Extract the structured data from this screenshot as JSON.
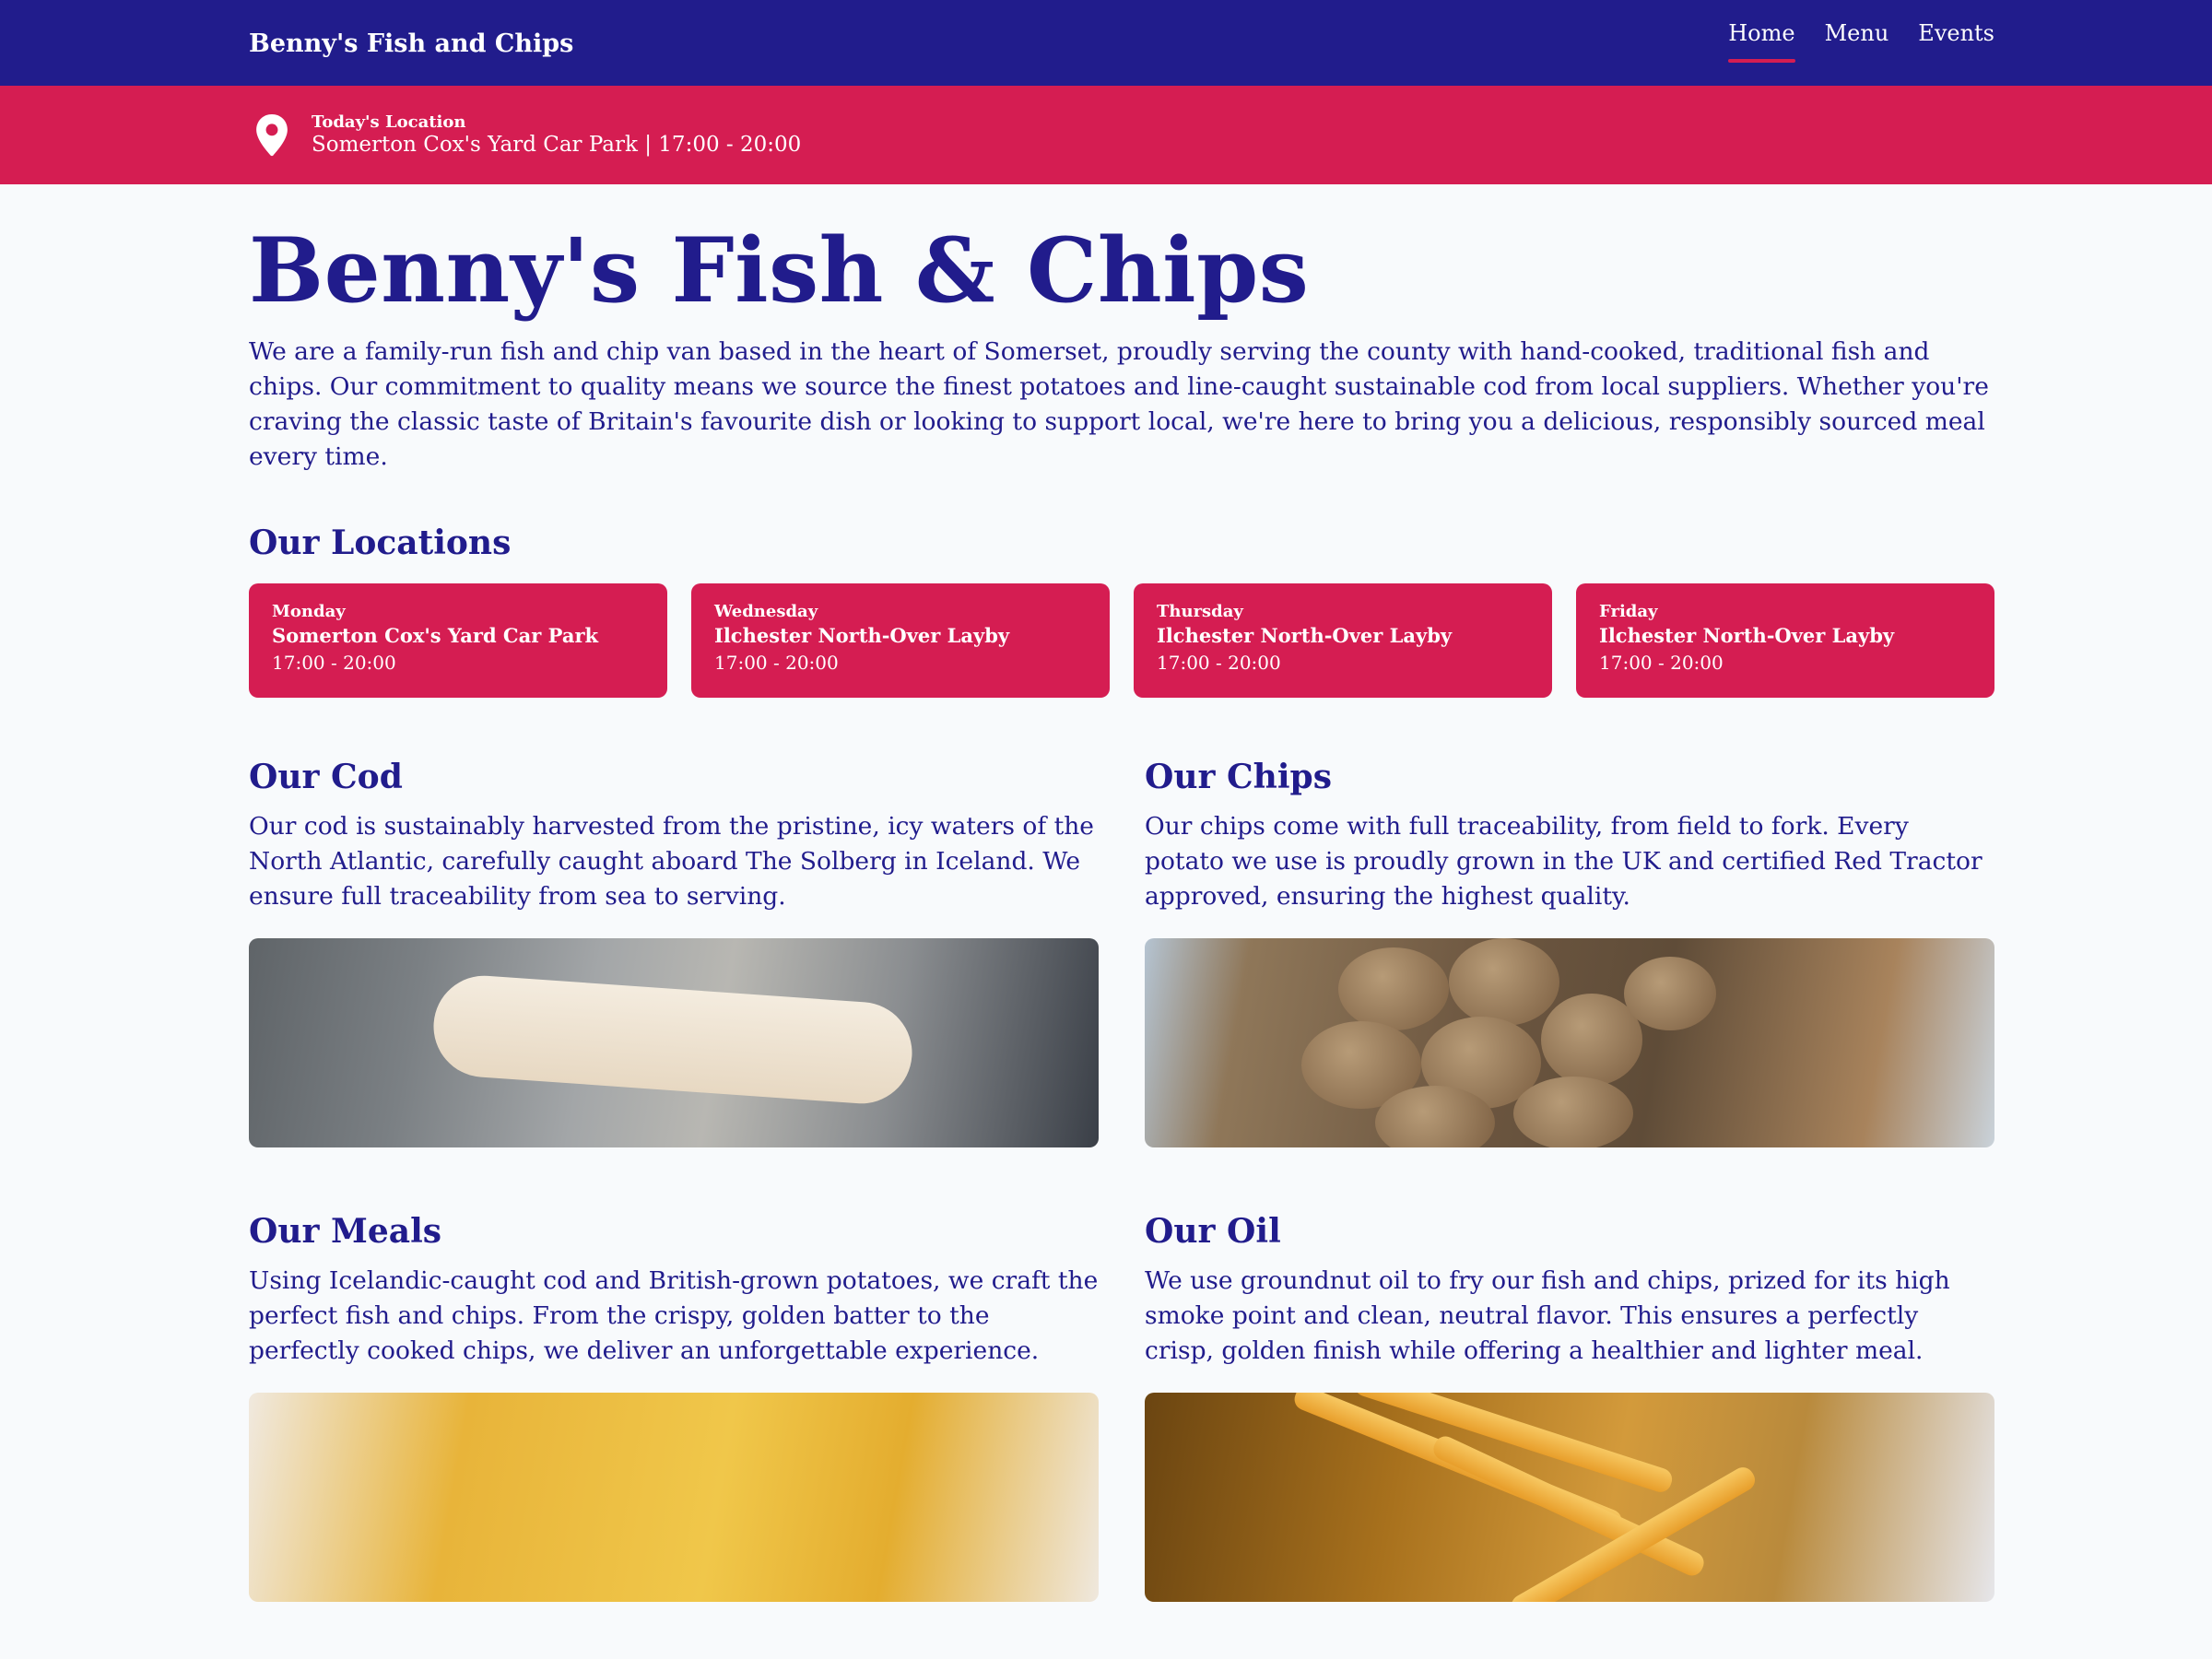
{
  "nav": {
    "brand": "Benny's Fish and Chips",
    "links": [
      "Home",
      "Menu",
      "Events"
    ],
    "active": "Home"
  },
  "banner": {
    "label": "Today's Location",
    "value": "Somerton Cox's Yard Car Park | 17:00 - 20:00",
    "icon": "map-pin-icon"
  },
  "hero": {
    "title": "Benny's Fish & Chips",
    "description": "We are a family-run fish and chip van based in the heart of Somerset, proudly serving the county with hand-cooked, traditional fish and chips. Our commitment to quality means we source the finest potatoes and line-caught sustainable cod from local suppliers. Whether you're craving the classic taste of Britain's favourite dish or looking to support local, we're here to bring you a delicious, responsibly sourced meal every time."
  },
  "locations": {
    "heading": "Our Locations",
    "cards": [
      {
        "day": "Monday",
        "place": "Somerton Cox's Yard Car Park",
        "time": "17:00 - 20:00"
      },
      {
        "day": "Wednesday",
        "place": "Ilchester North-Over Layby",
        "time": "17:00 - 20:00"
      },
      {
        "day": "Thursday",
        "place": "Ilchester North-Over Layby",
        "time": "17:00 - 20:00"
      },
      {
        "day": "Friday",
        "place": "Ilchester North-Over Layby",
        "time": "17:00 - 20:00"
      }
    ]
  },
  "features": [
    {
      "title": "Our Cod",
      "text": "Our cod is sustainably harvested from the pristine, icy waters of the North Atlantic, carefully caught aboard The Solberg in Iceland. We ensure full traceability from sea to serving."
    },
    {
      "title": "Our Chips",
      "text": "Our chips come with full traceability, from field to fork. Every potato we use is proudly grown in the UK and certified Red Tractor approved, ensuring the highest quality."
    },
    {
      "title": "Our Meals",
      "text": "Using Icelandic-caught cod and British-grown potatoes, we craft the perfect fish and chips. From the crispy, golden batter to the perfectly cooked chips, we deliver an unforgettable experience."
    },
    {
      "title": "Our Oil",
      "text": "We use groundnut oil to fry our fish and chips, prized for its high smoke point and clean, neutral flavor. This ensures a perfectly crisp, golden finish while offering a healthier and lighter meal."
    }
  ],
  "colors": {
    "primary": "#211c8c",
    "accent": "#d51d52",
    "background": "#f8fafc"
  }
}
